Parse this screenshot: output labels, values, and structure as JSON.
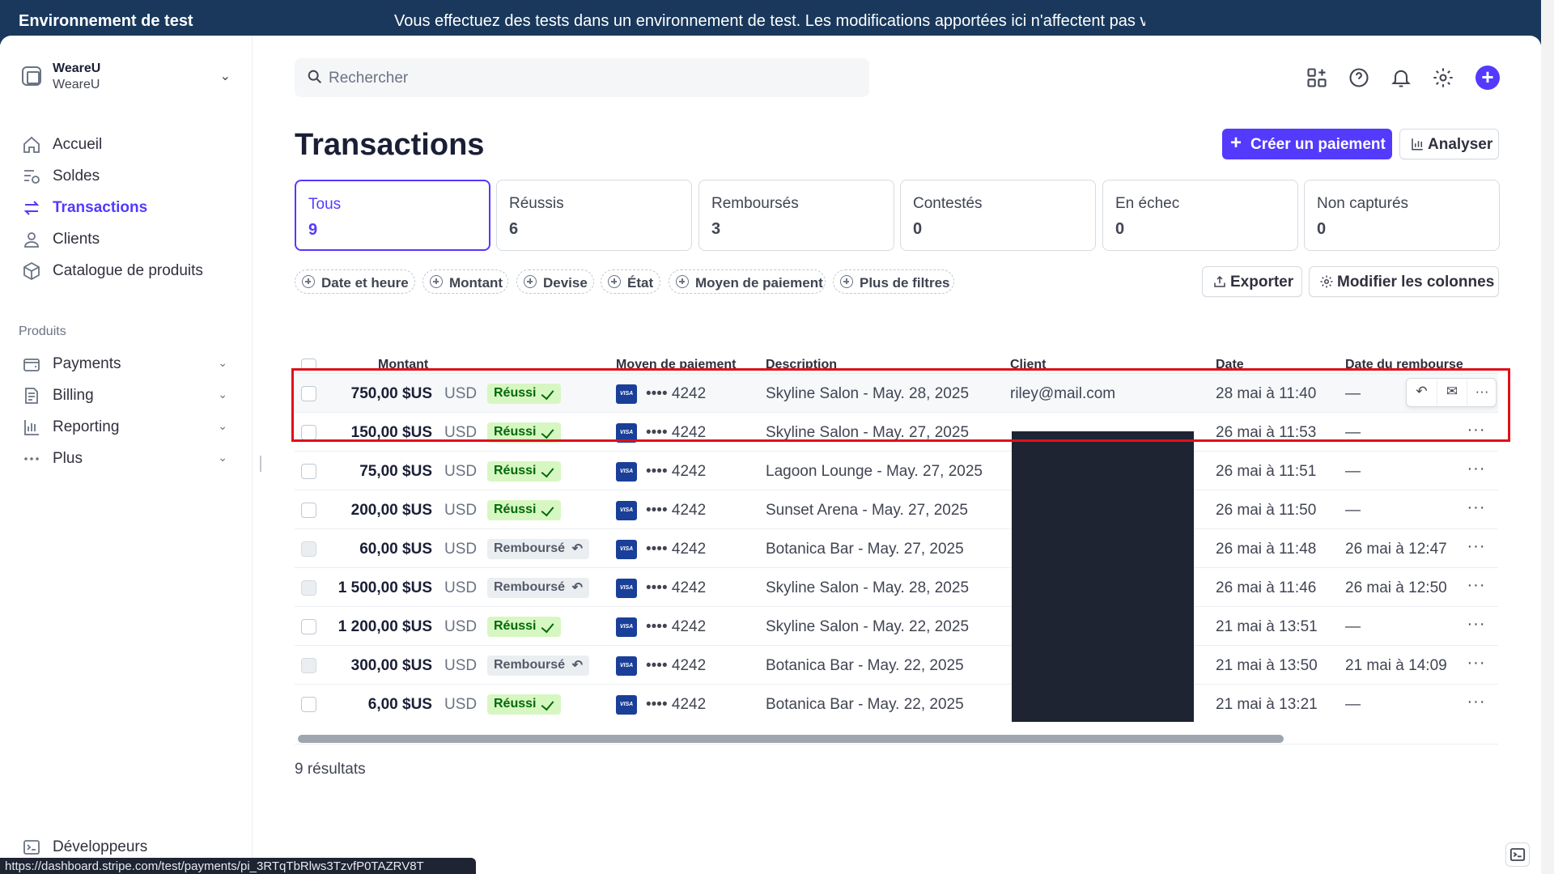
{
  "banner": {
    "env_label": "Environnement de test",
    "message": "Vous effectuez des tests dans un environnement de test. Les modifications apportées ici n'affectent pas votre"
  },
  "account": {
    "name": "WeareU",
    "sub": "WeareU"
  },
  "sidebar": {
    "items": [
      {
        "label": "Accueil",
        "icon": "home-icon"
      },
      {
        "label": "Soldes",
        "icon": "balances-icon"
      },
      {
        "label": "Transactions",
        "icon": "transactions-icon",
        "active": true
      },
      {
        "label": "Clients",
        "icon": "person-icon"
      },
      {
        "label": "Catalogue de produits",
        "icon": "box-icon"
      }
    ],
    "section_label": "Produits",
    "products": [
      {
        "label": "Payments",
        "icon": "wallet-icon"
      },
      {
        "label": "Billing",
        "icon": "billing-icon"
      },
      {
        "label": "Reporting",
        "icon": "bar-chart-icon"
      },
      {
        "label": "Plus",
        "icon": "dots-icon"
      }
    ],
    "developers": "Développeurs"
  },
  "search": {
    "placeholder": "Rechercher"
  },
  "page": {
    "title": "Transactions",
    "create_button": "Créer un paiement",
    "analyze_button": "Analyser",
    "export_button": "Exporter",
    "columns_button": "Modifier les colonnes",
    "results": "9 résultats"
  },
  "cards": [
    {
      "label": "Tous",
      "count": "9",
      "active": true
    },
    {
      "label": "Réussis",
      "count": "6"
    },
    {
      "label": "Remboursés",
      "count": "3"
    },
    {
      "label": "Contestés",
      "count": "0"
    },
    {
      "label": "En échec",
      "count": "0"
    },
    {
      "label": "Non capturés",
      "count": "0"
    }
  ],
  "filters": [
    "Date et heure",
    "Montant",
    "Devise",
    "État",
    "Moyen de paiement",
    "Plus de filtres"
  ],
  "table": {
    "columns": [
      "Montant",
      "Moyen de paiement",
      "Description",
      "Client",
      "Date",
      "Date du rembourse"
    ],
    "rows": [
      {
        "amount": "750,00 $US",
        "currency": "USD",
        "status": "Réussi",
        "last4": "•••• 4242",
        "description": "Skyline Salon - May. 28, 2025",
        "customer": "riley@mail.com",
        "date": "28 mai à 11:40",
        "refund_date": "—"
      },
      {
        "amount": "150,00 $US",
        "currency": "USD",
        "status": "Réussi",
        "last4": "•••• 4242",
        "description": "Skyline Salon - May. 27, 2025",
        "customer": "",
        "date": "26 mai à 11:53",
        "refund_date": "—"
      },
      {
        "amount": "75,00 $US",
        "currency": "USD",
        "status": "Réussi",
        "last4": "•••• 4242",
        "description": "Lagoon Lounge - May. 27, 2025",
        "customer": "",
        "date": "26 mai à 11:51",
        "refund_date": "—"
      },
      {
        "amount": "200,00 $US",
        "currency": "USD",
        "status": "Réussi",
        "last4": "•••• 4242",
        "description": "Sunset Arena - May. 27, 2025",
        "customer": "",
        "date": "26 mai à 11:50",
        "refund_date": "—"
      },
      {
        "amount": "60,00 $US",
        "currency": "USD",
        "status": "Remboursé",
        "last4": "•••• 4242",
        "description": "Botanica Bar - May. 27, 2025",
        "customer": "",
        "date": "26 mai à 11:48",
        "refund_date": "26 mai à 12:47"
      },
      {
        "amount": "1 500,00 $US",
        "currency": "USD",
        "status": "Remboursé",
        "last4": "•••• 4242",
        "description": "Skyline Salon - May. 28, 2025",
        "customer": "",
        "date": "26 mai à 11:46",
        "refund_date": "26 mai à 12:50"
      },
      {
        "amount": "1 200,00 $US",
        "currency": "USD",
        "status": "Réussi",
        "last4": "•••• 4242",
        "description": "Skyline Salon - May. 22, 2025",
        "customer": "",
        "date": "21 mai à 13:51",
        "refund_date": "—"
      },
      {
        "amount": "300,00 $US",
        "currency": "USD",
        "status": "Remboursé",
        "last4": "•••• 4242",
        "description": "Botanica Bar - May. 22, 2025",
        "customer": "",
        "date": "21 mai à 13:50",
        "refund_date": "21 mai à 14:09"
      },
      {
        "amount": "6,00 $US",
        "currency": "USD",
        "status": "Réussi",
        "last4": "•••• 4242",
        "description": "Botanica Bar - May. 22, 2025",
        "customer": "",
        "date": "21 mai à 13:21",
        "refund_date": "—"
      }
    ]
  },
  "card_brand": "VISA",
  "status_url": "https://dashboard.stripe.com/test/payments/pi_3RTqTbRlws3TzvfP0TAZRV8T",
  "colors": {
    "accent": "#533afd",
    "banner": "#19385c",
    "success_bg": "#d7f7c2",
    "success_fg": "#006908",
    "highlight_box": "#e0101a"
  }
}
